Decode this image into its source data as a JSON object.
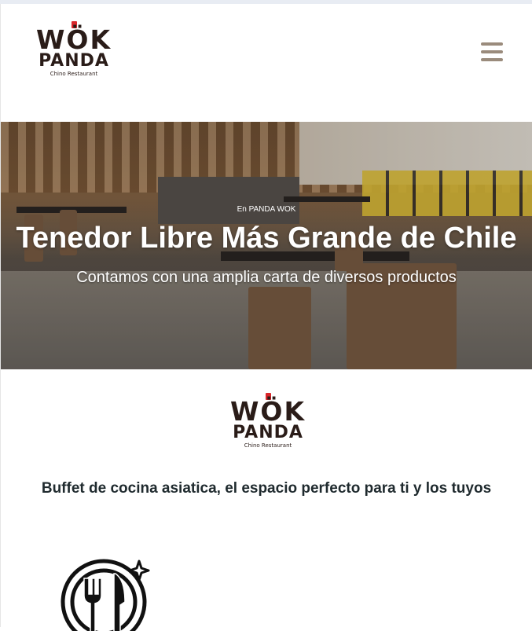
{
  "brand": {
    "name_line1": "WÖK",
    "name_line2": "PANDA",
    "tagline": "Chino Restaurant"
  },
  "header": {
    "menu_icon": "hamburger-menu-icon"
  },
  "hero": {
    "kicker": "En PANDA WOK",
    "title": "Tenedor Libre Más Grande de Chile",
    "subtitle": "Contamos con una amplia carta de diversos productos"
  },
  "intro": {
    "text": "Buffet de cocina asiatica, el espacio perfecto para ti y los tuyos"
  },
  "features": [
    {
      "icon": "plate-fork-knife-icon"
    }
  ],
  "colors": {
    "logo": "#2a1c18",
    "logo_seal": "#d9262a",
    "menu_icon": "#9a8b7c",
    "intro_text": "#1f2a2e"
  }
}
